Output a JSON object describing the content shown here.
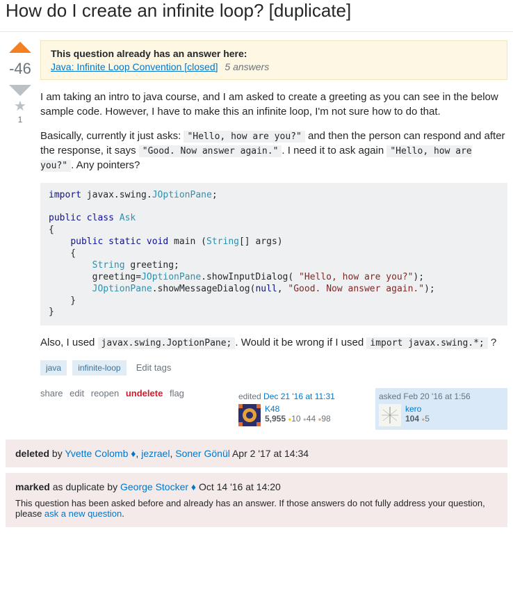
{
  "title": "How do I create an infinite loop? [duplicate]",
  "vote": {
    "score": "-46",
    "favorites": "1"
  },
  "duplicate": {
    "header": "This question already has an answer here:",
    "link_text": "Java: Infinite Loop Convention [closed]",
    "answers": "5 answers"
  },
  "post": {
    "p1": "I am taking an intro to java course, and I am asked to create a greeting as you can see in the below sample code. However, I have to make this an infinite loop, I'm not sure how to do that.",
    "p2_a": "Basically, currently it just asks: ",
    "p2_code1": "\"Hello, how are you?\"",
    "p2_b": " and then the person can respond and after the response, it says ",
    "p2_code2": "\"Good. Now answer again.\"",
    "p2_c": ". I need it to ask again ",
    "p2_code3": "\"Hello, how are you?\"",
    "p2_d": ". Any pointers?",
    "p3_a": "Also, I used ",
    "p3_code1": "javax.swing.JoptionPane;",
    "p3_b": ". Would it be wrong if I used ",
    "p3_code2": "import javax.swing.*;",
    "p3_c": " ?"
  },
  "code": {
    "kw_import": "import",
    "t1": " javax.swing.",
    "ty_jop": "JOptionPane",
    "semi": ";",
    "kw_public": "public",
    "kw_class": "class",
    "ty_ask": "Ask",
    "kw_static": "static",
    "kw_void": "void",
    "t_main": " main (",
    "ty_string": "String",
    "t_args": "[] args)",
    "ty_stringv": "String",
    "t_greeting": " greeting;",
    "t_assign": "        greeting=",
    "t_showInput": ".showInputDialog( ",
    "str_hello": "\"Hello, how are you?\"",
    "t_close1": ");",
    "t_showMsg": ".showMessageDialog(",
    "kw_null": "null",
    "t_comma": ", ",
    "str_good": "\"Good. Now answer again.\"",
    "t_close2": ");"
  },
  "tags": {
    "t1": "java",
    "t2": "infinite-loop",
    "edit": "Edit tags"
  },
  "actions": {
    "share": "share",
    "edit": "edit",
    "reopen": "reopen",
    "undelete": "undelete",
    "flag": "flag"
  },
  "editor": {
    "action": "edited ",
    "time": "Dec 21 '16 at 11:31",
    "name": "K48",
    "rep": "5,955",
    "gold": "10",
    "silver": "44",
    "bronze": "98"
  },
  "asker": {
    "action": "asked ",
    "time": "Feb 20 '16 at 1:56",
    "name": "kero",
    "rep": "104",
    "bronze": "5"
  },
  "deleted": {
    "label": "deleted",
    "by": " by ",
    "u1": "Yvette Colomb ♦",
    "c1": ", ",
    "u2": "jezrael",
    "c2": ", ",
    "u3": "Soner Gönül",
    "time": " Apr 2 '17 at 14:34"
  },
  "marked": {
    "label": "marked",
    "text": " as duplicate by ",
    "user": "George Stocker ♦",
    "time": " Oct 14 '16 at 14:20",
    "sub1": "This question has been asked before and already has an answer. If those answers do not fully address your question, please ",
    "sub_link": "ask a new question",
    "sub2": "."
  }
}
